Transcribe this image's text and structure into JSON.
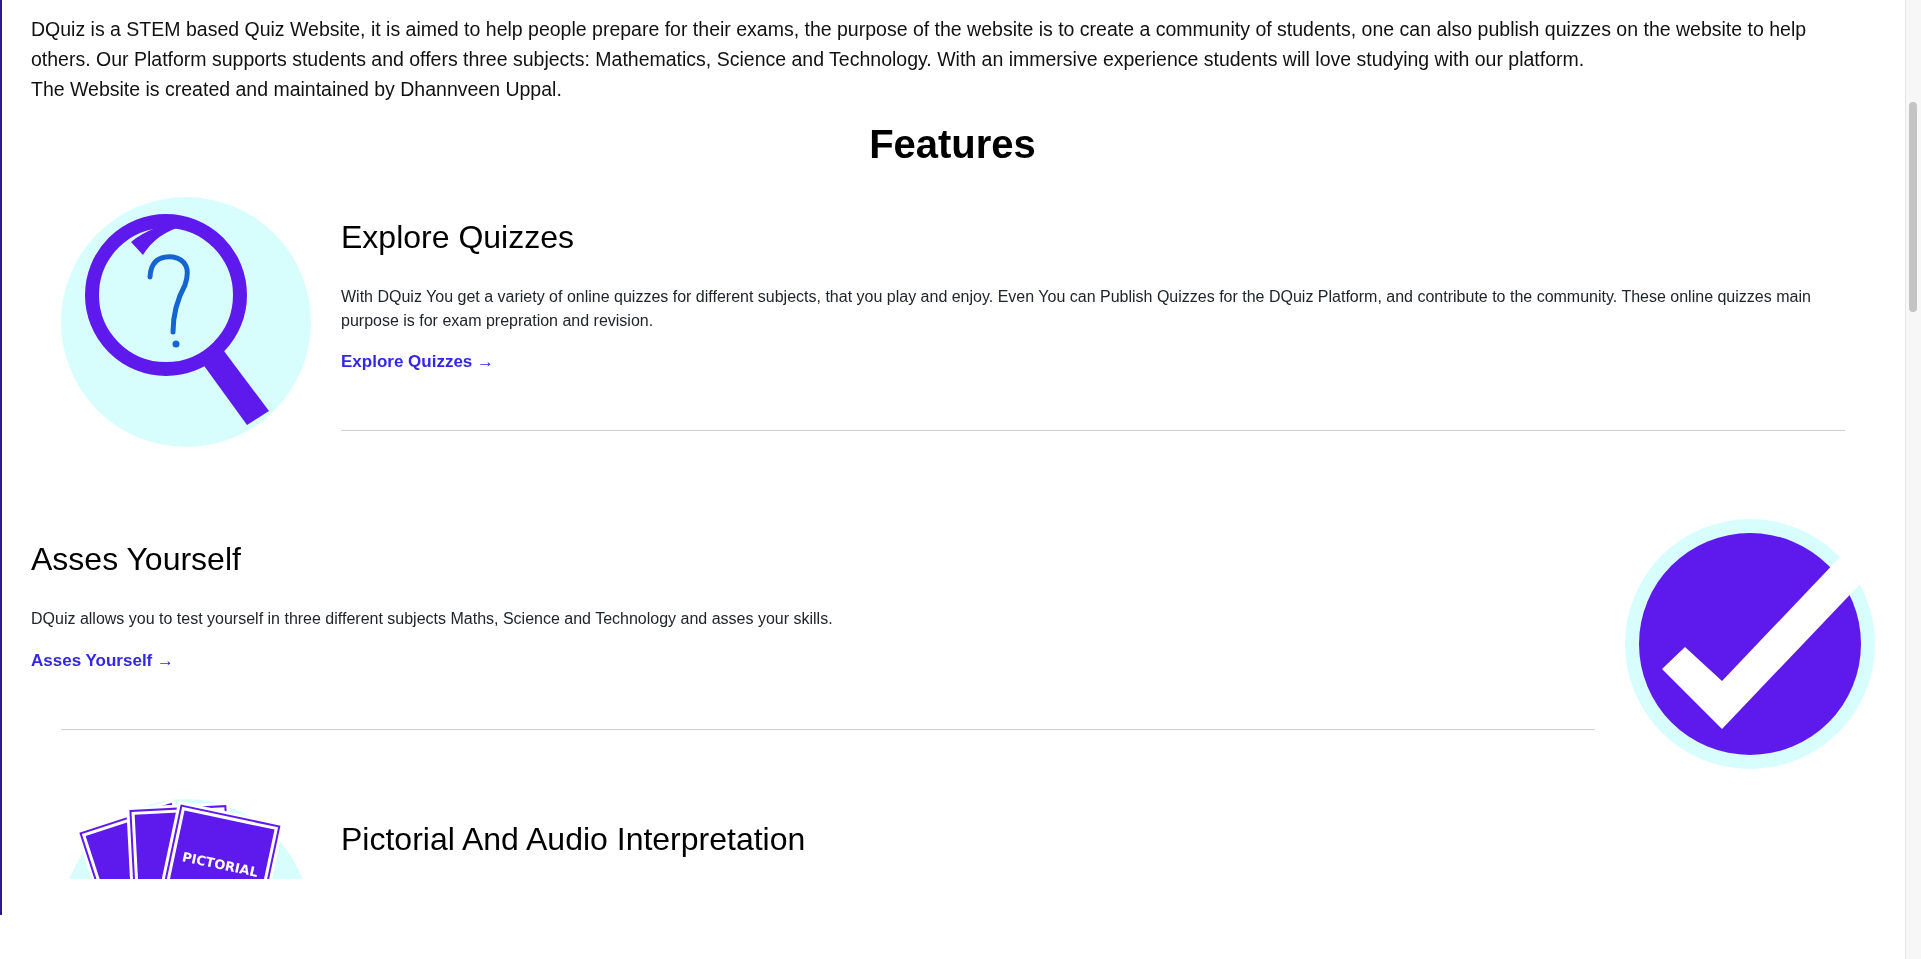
{
  "intro": [
    "DQuiz is a STEM based Quiz Website, it is aimed to help people prepare for their exams, the purpose of the website is to create a community of students, one can also publish quizzes on the website to help others. Our Platform supports students and offers three subjects: Mathematics, Science and Technology. With an immersive experience students will love studying with our platform.",
    "The Website is created and maintained by Dhannveen Uppal."
  ],
  "heading": "Features",
  "features": [
    {
      "kind": "magnifier",
      "title": "Explore Quizzes",
      "text": "With DQuiz You get a variety of online quizzes for different subjects, that you play and enjoy. Even You can Publish Quizzes for the DQuiz Platform, and contribute to the community. These online quizzes main purpose is for exam prepration and revision.",
      "link": "Explore Quizzes →"
    },
    {
      "kind": "check",
      "title": "Asses Yourself",
      "text": "DQuiz allows you to test yourself in three different subjects Maths, Science and Technology and asses your skills.",
      "link": "Asses Yourself →"
    },
    {
      "kind": "cards",
      "title": "Pictorial And Audio Interpretation",
      "image_text": "PICTORIAL"
    }
  ]
}
